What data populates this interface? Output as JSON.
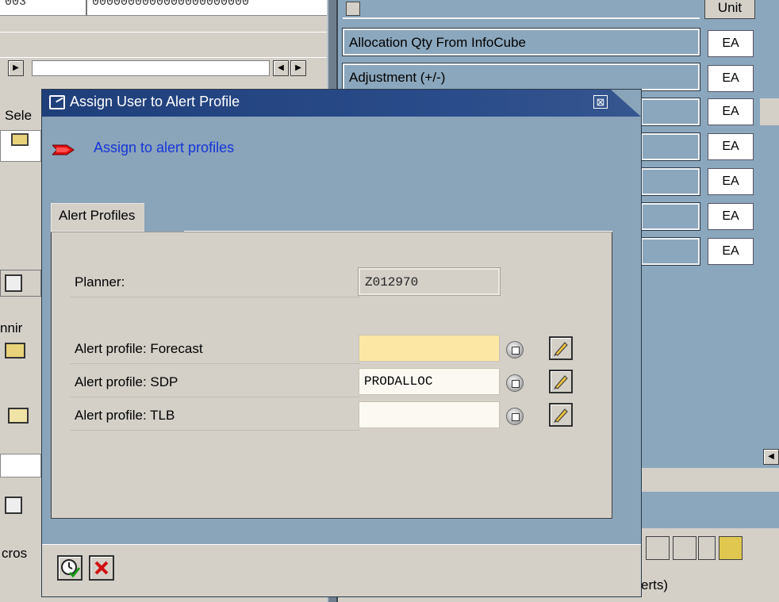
{
  "background": {
    "left_top_cell_a": "003",
    "left_top_cell_b": "0000000000000000000000",
    "left_side_labels": [
      "Sele",
      "nnir",
      "cros"
    ],
    "right_header_unit": "Unit",
    "right_rows": [
      {
        "label": "Allocation Qty From InfoCube",
        "unit": "EA"
      },
      {
        "label": "Adjustment (+/-)",
        "unit": "EA"
      },
      {
        "label": "",
        "unit": "EA"
      },
      {
        "label": "",
        "unit": "EA"
      },
      {
        "label": "",
        "unit": "EA"
      },
      {
        "label": "",
        "unit": "EA"
      },
      {
        "label": "",
        "unit": "EA"
      }
    ],
    "bottom_right_text": "erts)"
  },
  "dialog": {
    "title": "Assign User to Alert Profile",
    "close_symbol": "⊠",
    "action_link": "Assign to alert profiles",
    "group_title": "Alert Profiles",
    "fields": {
      "planner": {
        "label": "Planner:",
        "value": "Z012970"
      },
      "forecast": {
        "label": "Alert profile: Forecast",
        "value": ""
      },
      "sdp": {
        "label": "Alert profile: SDP",
        "value": "PRODALLOC"
      },
      "tlb": {
        "label": "Alert profile: TLB",
        "value": ""
      }
    }
  },
  "colors": {
    "title_bar": "#1f3f7a",
    "dialog_bg": "#8aa4ba",
    "required_field": "#fce8a4",
    "link": "#1636d8"
  },
  "icons": {
    "title": "window-icon",
    "action": "red-arrow-icon",
    "f4": "value-help-icon",
    "edit": "pencil-icon",
    "confirm": "clock-check-icon",
    "cancel": "red-x-icon"
  }
}
